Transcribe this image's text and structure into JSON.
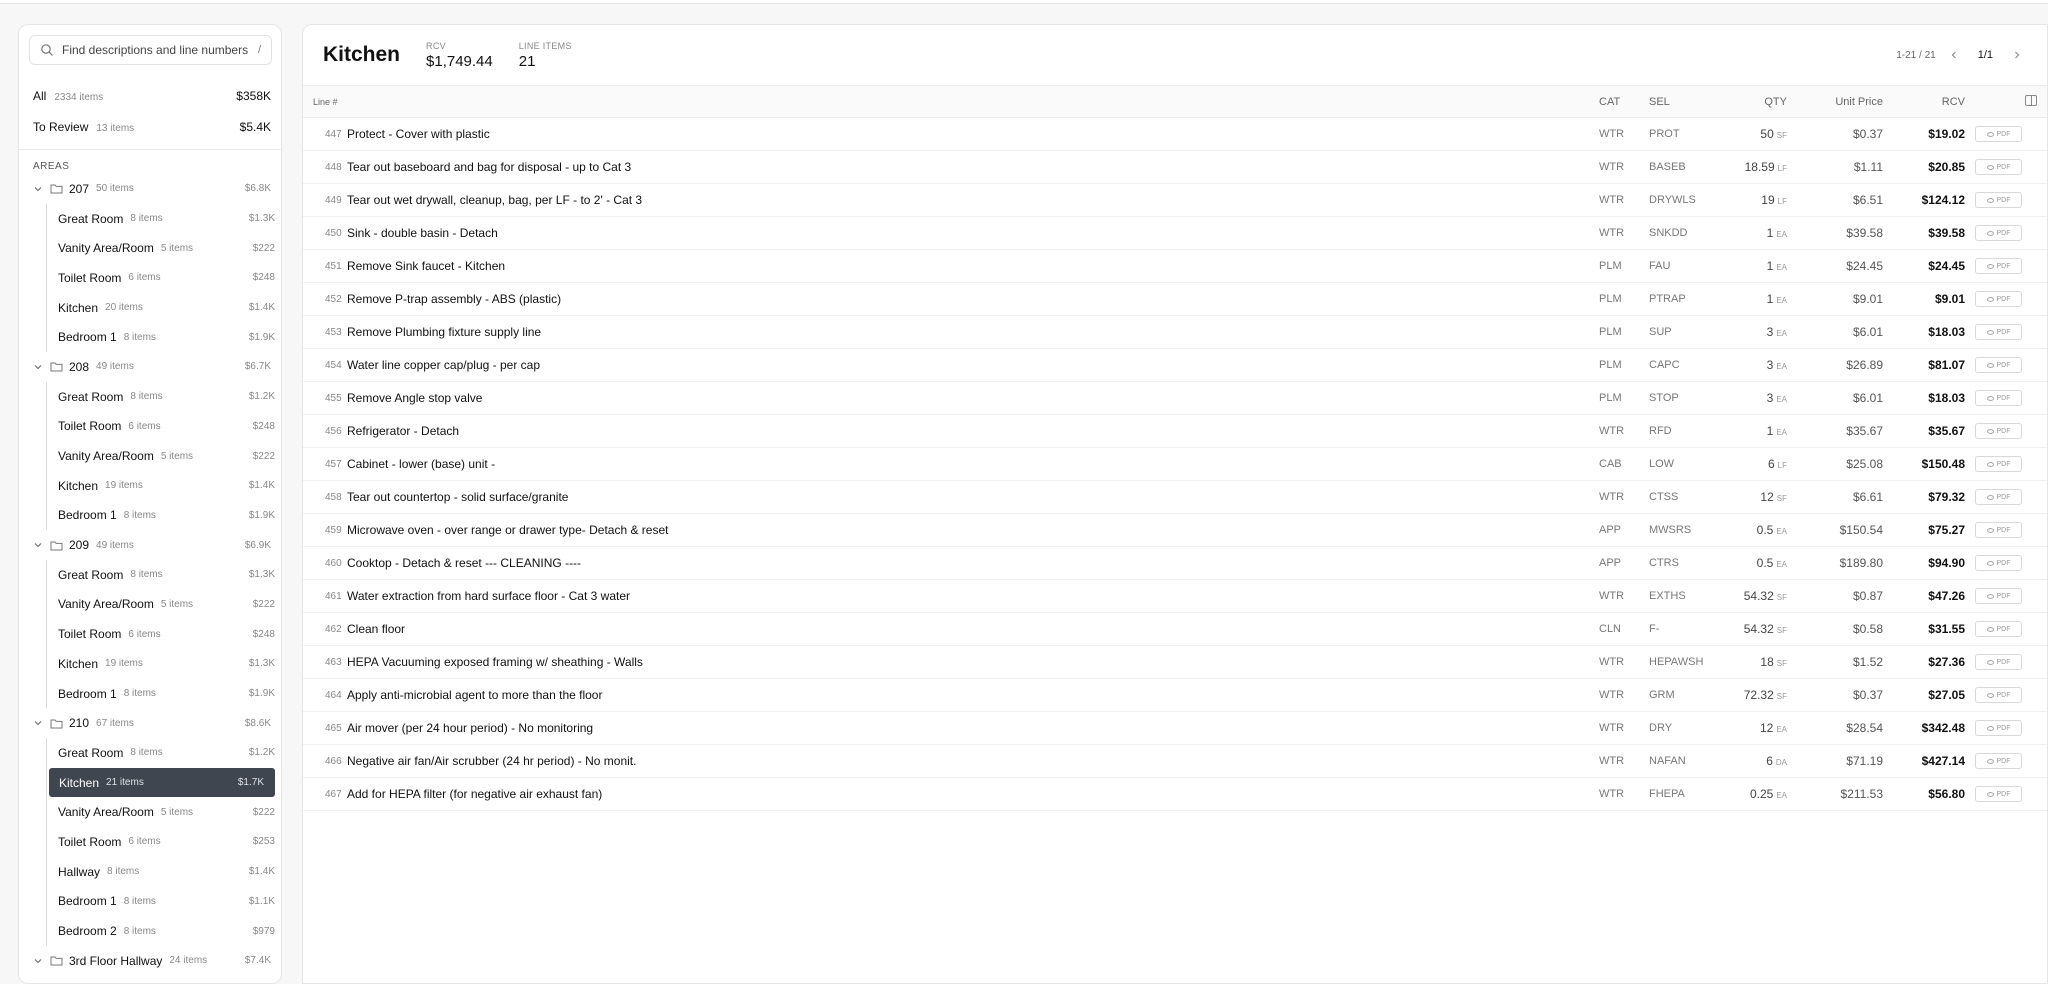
{
  "search": {
    "placeholder": "Find descriptions and line numbers",
    "shortcut": "/"
  },
  "summary": [
    {
      "label": "All",
      "count": "2334 items",
      "amount": "$358K"
    },
    {
      "label": "To Review",
      "count": "13 items",
      "amount": "$5.4K"
    }
  ],
  "areas_heading": "AREAS",
  "areas": [
    {
      "name": "207",
      "count": "50 items",
      "amount": "$6.8K",
      "children": [
        {
          "name": "Great Room",
          "count": "8 items",
          "amount": "$1.3K"
        },
        {
          "name": "Vanity Area/Room",
          "count": "5 items",
          "amount": "$222"
        },
        {
          "name": "Toilet Room",
          "count": "6 items",
          "amount": "$248"
        },
        {
          "name": "Kitchen",
          "count": "20 items",
          "amount": "$1.4K"
        },
        {
          "name": "Bedroom 1",
          "count": "8 items",
          "amount": "$1.9K"
        }
      ]
    },
    {
      "name": "208",
      "count": "49 items",
      "amount": "$6.7K",
      "children": [
        {
          "name": "Great Room",
          "count": "8 items",
          "amount": "$1.2K"
        },
        {
          "name": "Toilet Room",
          "count": "6 items",
          "amount": "$248"
        },
        {
          "name": "Vanity Area/Room",
          "count": "5 items",
          "amount": "$222"
        },
        {
          "name": "Kitchen",
          "count": "19 items",
          "amount": "$1.4K"
        },
        {
          "name": "Bedroom 1",
          "count": "8 items",
          "amount": "$1.9K"
        }
      ]
    },
    {
      "name": "209",
      "count": "49 items",
      "amount": "$6.9K",
      "children": [
        {
          "name": "Great Room",
          "count": "8 items",
          "amount": "$1.3K"
        },
        {
          "name": "Vanity Area/Room",
          "count": "5 items",
          "amount": "$222"
        },
        {
          "name": "Toilet Room",
          "count": "6 items",
          "amount": "$248"
        },
        {
          "name": "Kitchen",
          "count": "19 items",
          "amount": "$1.3K"
        },
        {
          "name": "Bedroom 1",
          "count": "8 items",
          "amount": "$1.9K"
        }
      ]
    },
    {
      "name": "210",
      "count": "67 items",
      "amount": "$8.6K",
      "children": [
        {
          "name": "Great Room",
          "count": "8 items",
          "amount": "$1.2K"
        },
        {
          "name": "Kitchen",
          "count": "21 items",
          "amount": "$1.7K",
          "active": true
        },
        {
          "name": "Vanity Area/Room",
          "count": "5 items",
          "amount": "$222"
        },
        {
          "name": "Toilet Room",
          "count": "6 items",
          "amount": "$253"
        },
        {
          "name": "Hallway",
          "count": "8 items",
          "amount": "$1.4K"
        },
        {
          "name": "Bedroom 1",
          "count": "8 items",
          "amount": "$1.1K"
        },
        {
          "name": "Bedroom 2",
          "count": "8 items",
          "amount": "$979"
        }
      ]
    },
    {
      "name": "3rd Floor Hallway",
      "count": "24 items",
      "amount": "$7.4K",
      "children": []
    }
  ],
  "main": {
    "title": "Kitchen",
    "rcv_label": "RCV",
    "rcv_value": "$1,749.44",
    "items_label": "LINE ITEMS",
    "items_value": "21",
    "range": "1-21 / 21",
    "page": "1/1"
  },
  "columns": {
    "line": "Line #",
    "cat": "CAT",
    "sel": "SEL",
    "qty": "QTY",
    "unit_price": "Unit Price",
    "rcv": "RCV"
  },
  "pdf_label": "PDF",
  "rows": [
    {
      "line": "447",
      "desc": "Protect - Cover with plastic",
      "cat": "WTR",
      "sel": "PROT",
      "qty": "50",
      "unit": "SF",
      "up": "$0.37",
      "rcv": "$19.02"
    },
    {
      "line": "448",
      "desc": "Tear out baseboard and bag for disposal - up to Cat 3",
      "cat": "WTR",
      "sel": "BASEB",
      "qty": "18.59",
      "unit": "LF",
      "up": "$1.11",
      "rcv": "$20.85"
    },
    {
      "line": "449",
      "desc": "Tear out wet drywall, cleanup, bag, per LF - to 2' - Cat 3",
      "cat": "WTR",
      "sel": "DRYWLS",
      "qty": "19",
      "unit": "LF",
      "up": "$6.51",
      "rcv": "$124.12"
    },
    {
      "line": "450",
      "desc": "Sink - double basin - Detach",
      "cat": "WTR",
      "sel": "SNKDD",
      "qty": "1",
      "unit": "EA",
      "up": "$39.58",
      "rcv": "$39.58"
    },
    {
      "line": "451",
      "desc": "Remove Sink faucet - Kitchen",
      "cat": "PLM",
      "sel": "FAU",
      "qty": "1",
      "unit": "EA",
      "up": "$24.45",
      "rcv": "$24.45"
    },
    {
      "line": "452",
      "desc": "Remove P-trap assembly - ABS (plastic)",
      "cat": "PLM",
      "sel": "PTRAP",
      "qty": "1",
      "unit": "EA",
      "up": "$9.01",
      "rcv": "$9.01"
    },
    {
      "line": "453",
      "desc": "Remove Plumbing fixture supply line",
      "cat": "PLM",
      "sel": "SUP",
      "qty": "3",
      "unit": "EA",
      "up": "$6.01",
      "rcv": "$18.03"
    },
    {
      "line": "454",
      "desc": "Water line copper cap/plug - per cap",
      "cat": "PLM",
      "sel": "CAPC",
      "qty": "3",
      "unit": "EA",
      "up": "$26.89",
      "rcv": "$81.07"
    },
    {
      "line": "455",
      "desc": "Remove Angle stop valve",
      "cat": "PLM",
      "sel": "STOP",
      "qty": "3",
      "unit": "EA",
      "up": "$6.01",
      "rcv": "$18.03"
    },
    {
      "line": "456",
      "desc": "Refrigerator - Detach",
      "cat": "WTR",
      "sel": "RFD",
      "qty": "1",
      "unit": "EA",
      "up": "$35.67",
      "rcv": "$35.67"
    },
    {
      "line": "457",
      "desc": "Cabinet - lower (base) unit -",
      "cat": "CAB",
      "sel": "LOW",
      "qty": "6",
      "unit": "LF",
      "up": "$25.08",
      "rcv": "$150.48"
    },
    {
      "line": "458",
      "desc": "Tear out countertop - solid surface/granite",
      "cat": "WTR",
      "sel": "CTSS",
      "qty": "12",
      "unit": "SF",
      "up": "$6.61",
      "rcv": "$79.32"
    },
    {
      "line": "459",
      "desc": "Microwave oven - over range or drawer type- Detach & reset",
      "cat": "APP",
      "sel": "MWSRS",
      "qty": "0.5",
      "unit": "EA",
      "up": "$150.54",
      "rcv": "$75.27"
    },
    {
      "line": "460",
      "desc": "Cooktop - Detach & reset --- CLEANING ----",
      "cat": "APP",
      "sel": "CTRS",
      "qty": "0.5",
      "unit": "EA",
      "up": "$189.80",
      "rcv": "$94.90"
    },
    {
      "line": "461",
      "desc": "Water extraction from hard surface floor - Cat 3 water",
      "cat": "WTR",
      "sel": "EXTHS",
      "qty": "54.32",
      "unit": "SF",
      "up": "$0.87",
      "rcv": "$47.26"
    },
    {
      "line": "462",
      "desc": "Clean floor",
      "cat": "CLN",
      "sel": "F-",
      "qty": "54.32",
      "unit": "SF",
      "up": "$0.58",
      "rcv": "$31.55"
    },
    {
      "line": "463",
      "desc": "HEPA Vacuuming exposed framing w/ sheathing - Walls",
      "cat": "WTR",
      "sel": "HEPAWSH",
      "qty": "18",
      "unit": "SF",
      "up": "$1.52",
      "rcv": "$27.36"
    },
    {
      "line": "464",
      "desc": "Apply anti-microbial agent to more than the floor",
      "cat": "WTR",
      "sel": "GRM",
      "qty": "72.32",
      "unit": "SF",
      "up": "$0.37",
      "rcv": "$27.05"
    },
    {
      "line": "465",
      "desc": "Air mover (per 24 hour period) - No monitoring",
      "cat": "WTR",
      "sel": "DRY",
      "qty": "12",
      "unit": "EA",
      "up": "$28.54",
      "rcv": "$342.48"
    },
    {
      "line": "466",
      "desc": "Negative air fan/Air scrubber (24 hr period) - No monit.",
      "cat": "WTR",
      "sel": "NAFAN",
      "qty": "6",
      "unit": "DA",
      "up": "$71.19",
      "rcv": "$427.14"
    },
    {
      "line": "467",
      "desc": "Add for HEPA filter (for negative air exhaust fan)",
      "cat": "WTR",
      "sel": "FHEPA",
      "qty": "0.25",
      "unit": "EA",
      "up": "$211.53",
      "rcv": "$56.80"
    }
  ]
}
